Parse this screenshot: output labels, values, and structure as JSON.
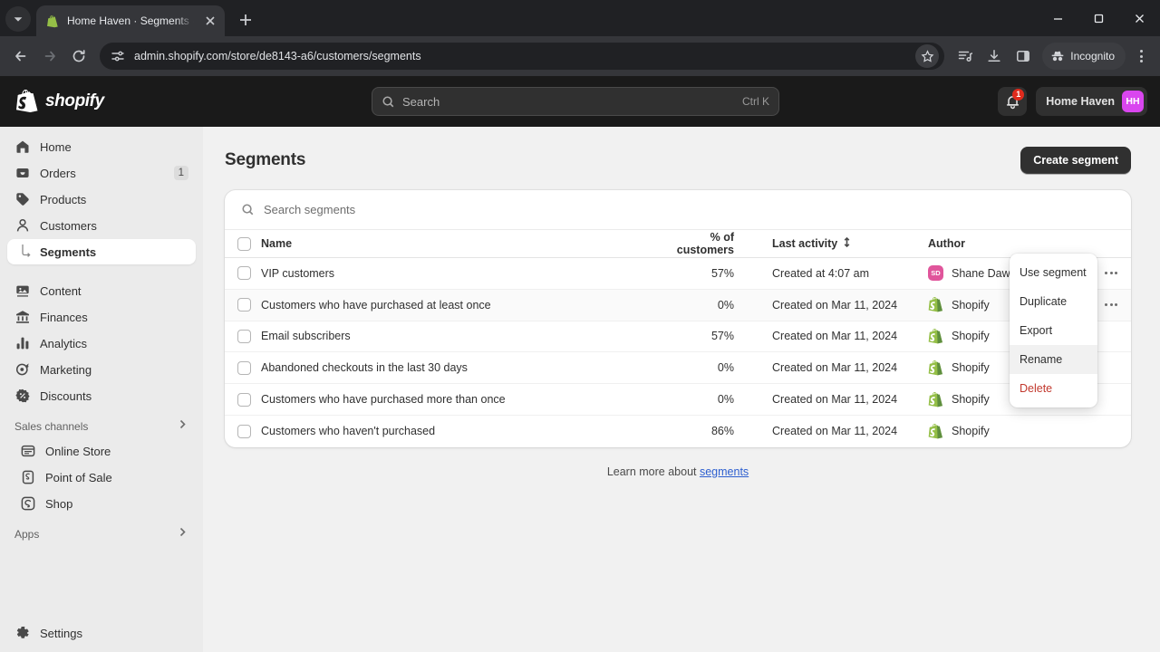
{
  "browser": {
    "tab": {
      "title": "Home Haven · Segments · Shop",
      "favicon": "shopify-bag-icon"
    },
    "new_tab_label": "+",
    "url": "admin.shopify.com/store/de8143-a6/customers/segments",
    "incognito_label": "Incognito",
    "icons": [
      "back-icon",
      "forward-icon",
      "reload-icon",
      "site-settings-icon",
      "bookmark-star-icon",
      "reading-list-icon",
      "download-icon",
      "side-panel-icon",
      "incognito-icon",
      "browser-menu-icon"
    ]
  },
  "topbar": {
    "brand": "shopify",
    "search": {
      "placeholder": "Search",
      "shortcut": "Ctrl K"
    },
    "notifications_count": "1",
    "store_name": "Home Haven",
    "store_initials": "HH",
    "avatar_color": "#d946ef"
  },
  "sidebar": {
    "items": [
      {
        "label": "Home",
        "icon": "home-icon",
        "count": ""
      },
      {
        "label": "Orders",
        "icon": "orders-icon",
        "count": "1"
      },
      {
        "label": "Products",
        "icon": "products-tag-icon",
        "count": ""
      },
      {
        "label": "Customers",
        "icon": "customers-person-icon",
        "count": ""
      }
    ],
    "sub_item": {
      "label": "Segments",
      "active": true
    },
    "items2": [
      {
        "label": "Content",
        "icon": "content-icon",
        "count": ""
      },
      {
        "label": "Finances",
        "icon": "finances-bank-icon",
        "count": ""
      },
      {
        "label": "Analytics",
        "icon": "analytics-bars-icon",
        "count": ""
      },
      {
        "label": "Marketing",
        "icon": "marketing-target-icon",
        "count": ""
      },
      {
        "label": "Discounts",
        "icon": "discounts-badge-icon",
        "count": ""
      }
    ],
    "sales_channels": {
      "label": "Sales channels",
      "channels": [
        {
          "label": "Online Store",
          "icon": "online-store-icon"
        },
        {
          "label": "Point of Sale",
          "icon": "point-of-sale-icon"
        },
        {
          "label": "Shop",
          "icon": "shop-icon"
        }
      ]
    },
    "apps": {
      "label": "Apps"
    },
    "settings": {
      "label": "Settings",
      "icon": "gear-icon"
    }
  },
  "main": {
    "title": "Segments",
    "create_button": "Create segment",
    "search_placeholder": "Search segments",
    "columns": {
      "name": "Name",
      "percent": "% of customers",
      "last_activity": "Last activity",
      "author": "Author"
    },
    "rows": [
      {
        "name": "VIP customers",
        "percent": "57%",
        "activity": "Created at 4:07 am",
        "author": "Shane Dawson",
        "author_type": "user",
        "initials": "SD",
        "avatar_color": "#e0559b",
        "hover": false
      },
      {
        "name": "Customers who have purchased at least once",
        "percent": "0%",
        "activity": "Created on Mar 11, 2024",
        "author": "Shopify",
        "author_type": "shopify",
        "initials": "",
        "avatar_color": "#95bf47",
        "hover": true
      },
      {
        "name": "Email subscribers",
        "percent": "57%",
        "activity": "Created on Mar 11, 2024",
        "author": "Shopify",
        "author_type": "shopify",
        "initials": "",
        "avatar_color": "#95bf47",
        "hover": false
      },
      {
        "name": "Abandoned checkouts in the last 30 days",
        "percent": "0%",
        "activity": "Created on Mar 11, 2024",
        "author": "Shopify",
        "author_type": "shopify",
        "initials": "",
        "avatar_color": "#95bf47",
        "hover": false
      },
      {
        "name": "Customers who have purchased more than once",
        "percent": "0%",
        "activity": "Created on Mar 11, 2024",
        "author": "Shopify",
        "author_type": "shopify",
        "initials": "",
        "avatar_color": "#95bf47",
        "hover": false
      },
      {
        "name": "Customers who haven't purchased",
        "percent": "86%",
        "activity": "Created on Mar 11, 2024",
        "author": "Shopify",
        "author_type": "shopify",
        "initials": "",
        "avatar_color": "#95bf47",
        "hover": false
      }
    ],
    "learn_more_prefix": "Learn more about ",
    "learn_more_link": "segments"
  },
  "context_menu": {
    "items": [
      {
        "label": "Use segment",
        "hovered": false,
        "danger": false
      },
      {
        "label": "Duplicate",
        "hovered": false,
        "danger": false
      },
      {
        "label": "Export",
        "hovered": false,
        "danger": false
      },
      {
        "label": "Rename",
        "hovered": true,
        "danger": false
      },
      {
        "label": "Delete",
        "hovered": false,
        "danger": true
      }
    ]
  }
}
